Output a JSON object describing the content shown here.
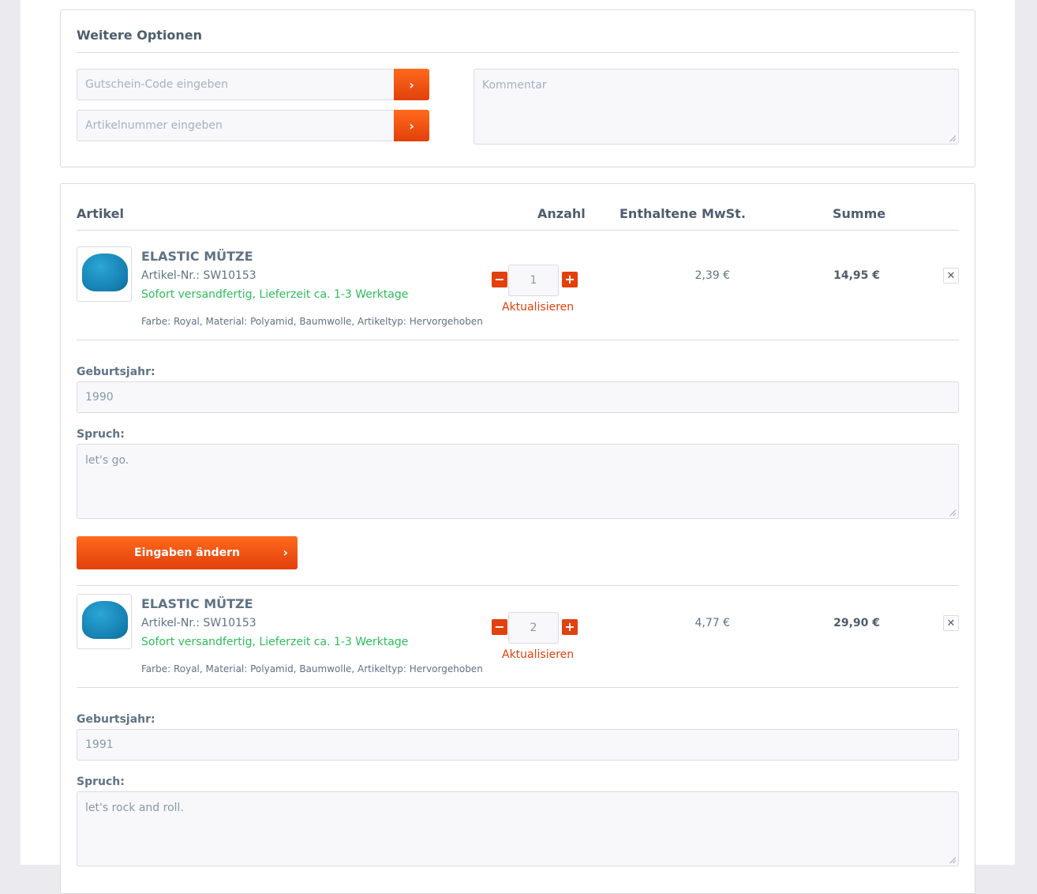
{
  "options": {
    "title": "Weitere Optionen",
    "voucher_placeholder": "Gutschein-Code eingeben",
    "articlenumber_placeholder": "Artikelnummer eingeben",
    "comment_placeholder": "Kommentar",
    "submit_glyph": "›"
  },
  "cart": {
    "headers": {
      "article": "Artikel",
      "quantity": "Anzahl",
      "tax": "Enthaltene MwSt.",
      "total": "Summe"
    },
    "update_label": "Aktualisieren",
    "remove_glyph": "✕",
    "minus_glyph": "−",
    "plus_glyph": "+",
    "items": [
      {
        "name": "ELASTIC MÜTZE",
        "number": "Artikel-Nr.: SW10153",
        "shipping": "Sofort versandfertig, Lieferzeit ca. 1-3 Werktage",
        "attributes": "Farbe: Royal, Material: Polyamid, Baumwolle, Artikeltyp: Hervorgehoben",
        "quantity": "1",
        "tax": "2,39 €",
        "total": "14,95 €",
        "birthyear_label": "Geburtsjahr:",
        "birthyear_value": "1990",
        "slogan_label": "Spruch:",
        "slogan_value": "let's go.",
        "change_button": "Eingaben ändern",
        "change_glyph": "›"
      },
      {
        "name": "ELASTIC MÜTZE",
        "number": "Artikel-Nr.: SW10153",
        "shipping": "Sofort versandfertig, Lieferzeit ca. 1-3 Werktage",
        "attributes": "Farbe: Royal, Material: Polyamid, Baumwolle, Artikeltyp: Hervorgehoben",
        "quantity": "2",
        "tax": "4,77 €",
        "total": "29,90 €",
        "birthyear_label": "Geburtsjahr:",
        "birthyear_value": "1991",
        "slogan_label": "Spruch:",
        "slogan_value": "let's rock and roll."
      }
    ]
  },
  "colors": {
    "accent": "#e2400c",
    "shipping_green": "#2ebd59",
    "text": "#5f7285",
    "border": "#dadae5"
  },
  "icons": {
    "submit": "chevron-right-icon",
    "remove": "close-icon",
    "minus": "minus-icon",
    "plus": "plus-icon"
  }
}
